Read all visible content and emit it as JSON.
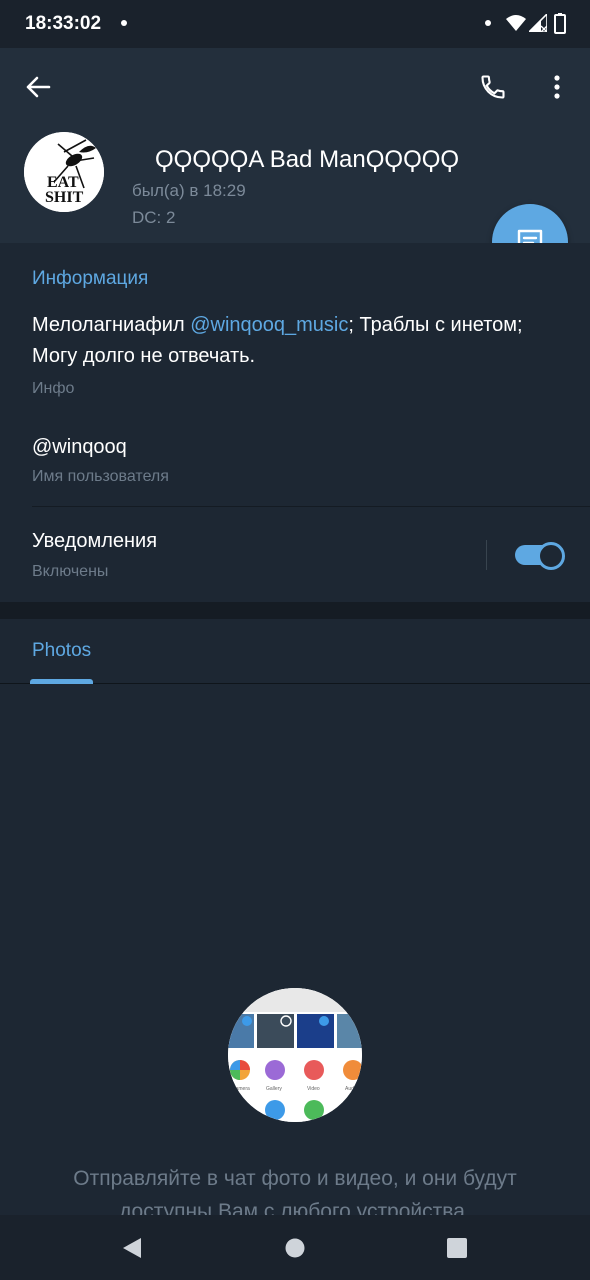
{
  "status_bar": {
    "time": "18:33:02",
    "icons": [
      "notification-dot-icon",
      "dot-icon",
      "wifi-icon",
      "signal-icon",
      "battery-icon"
    ]
  },
  "toolbar": {
    "back_icon": "arrow-left-icon",
    "call_icon": "phone-icon",
    "menu_icon": "more-vertical-icon"
  },
  "profile": {
    "name": "ϘϘϘϘϘA Bad ManϘϘϘϘϘ",
    "last_seen": "был(а) в 18:29",
    "dc": "DC: 2",
    "avatar_text_line1": "EAT",
    "avatar_text_line2": "SHIT"
  },
  "fab": {
    "icon": "message-icon"
  },
  "info_section": {
    "title": "Информация",
    "bio_prefix": "Мелолагниафил ",
    "bio_link": "@winqooq_music",
    "bio_suffix": "; Траблы с инетом; Могу долго не отвечать.",
    "bio_caption": "Инфо",
    "username": "@winqooq",
    "username_caption": "Имя пользователя",
    "notifications_label": "Уведомления",
    "notifications_status": "Включены",
    "notifications_enabled": true
  },
  "tabs": [
    {
      "label": "Photos",
      "active": true
    }
  ],
  "empty_state": {
    "text": "Отправляйте в чат фото и видео, и они будут доступны Вам с любого устройства.",
    "illustration_labels": [
      "Camera",
      "Gallery",
      "Video",
      "Audio"
    ]
  },
  "colors": {
    "accent": "#5ea8e2",
    "header_bg": "#232f3c",
    "page_bg": "#1d2733",
    "secondary_text": "#7c8a99"
  }
}
